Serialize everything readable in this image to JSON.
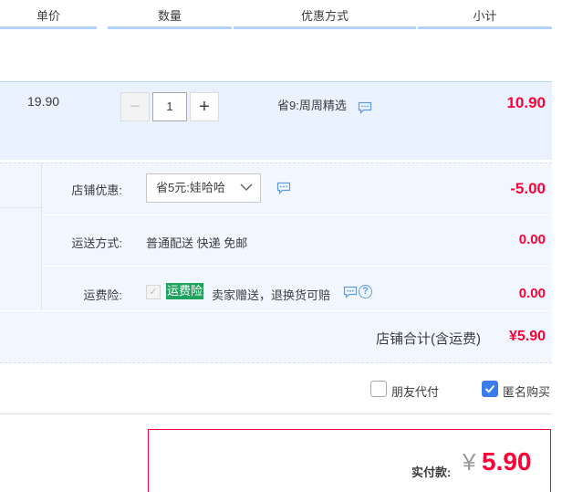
{
  "header": {
    "col_unit_price": "单价",
    "col_quantity": "数量",
    "col_discount": "优惠方式",
    "col_subtotal": "小计"
  },
  "item": {
    "unit_price": "19.90",
    "quantity": "1",
    "minus_label": "−",
    "plus_label": "+",
    "promotion": "省9:周周精选",
    "subtotal": "10.90"
  },
  "shop": {
    "discount_label": "店铺优惠:",
    "discount_selected": "省5元:娃哈哈",
    "discount_amount": "-5.00",
    "shipping_label": "运送方式:",
    "shipping_value": "普通配送 快递 免邮",
    "shipping_amount": "0.00",
    "insurance_label": "运费险:",
    "insurance_badge": "运费险",
    "insurance_text": "卖家赠送，退换货可赔",
    "insurance_checked": true,
    "insurance_amount": "0.00",
    "total_label": "店铺合计(含运费)",
    "total_value": "¥5.90"
  },
  "options": {
    "friend_pay_label": "朋友代付",
    "friend_pay_checked": false,
    "anonymous_label": "匿名购买",
    "anonymous_checked": true
  },
  "payment": {
    "label": "实付款:",
    "currency": "¥",
    "value": "5.90"
  },
  "colors": {
    "price_red": "#ff0036",
    "header_border": "#b2d1ff",
    "row_bg": "#eaf2ff",
    "badge_green": "#21a35f",
    "checkbox_blue": "#3a7ce9"
  },
  "icons": {
    "message": "message-bubble-icon",
    "help": "question-circle-icon",
    "chevron": "chevron-down-icon",
    "check": "checkmark-icon"
  }
}
